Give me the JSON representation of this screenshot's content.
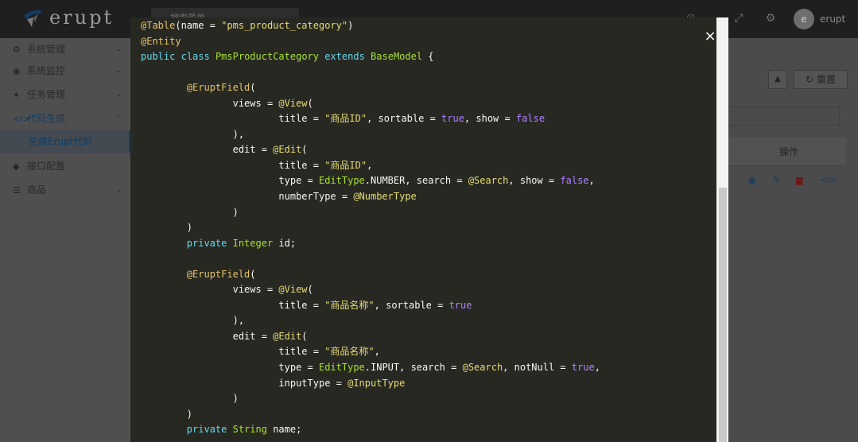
{
  "app": {
    "logo_text": "erupt",
    "search_placeholder": "搜索菜单",
    "username": "erupt",
    "avatar_letter": "e"
  },
  "sidebar": {
    "items": [
      {
        "label": "系统管理",
        "icon": "gears-icon"
      },
      {
        "label": "系统监控",
        "icon": "monitor-icon"
      },
      {
        "label": "任务管理",
        "icon": "tasks-icon"
      },
      {
        "label": "代码生成",
        "icon": "code-icon"
      },
      {
        "label": "生成Erupt代码",
        "icon": ""
      },
      {
        "label": "接口配置",
        "icon": "cube-icon"
      },
      {
        "label": "商品",
        "icon": "list-icon"
      }
    ]
  },
  "toolbar": {
    "reset_label": "重置"
  },
  "table": {
    "ops_header": "操作"
  },
  "modal": {
    "close_symbol": "×"
  },
  "code_lines": [
    "@Table(name = \"pms_product_category\")",
    "@Entity",
    "public class PmsProductCategory extends BaseModel {",
    "",
    "        @EruptField(",
    "                views = @View(",
    "                        title = \"商品ID\", sortable = true, show = false",
    "                ),",
    "                edit = @Edit(",
    "                        title = \"商品ID\",",
    "                        type = EditType.NUMBER, search = @Search, show = false,",
    "                        numberType = @NumberType",
    "                )",
    "        )",
    "        private Integer id;",
    "",
    "        @EruptField(",
    "                views = @View(",
    "                        title = \"商品名称\", sortable = true",
    "                ),",
    "                edit = @Edit(",
    "                        title = \"商品名称\",",
    "                        type = EditType.INPUT, search = @Search, notNull = true,",
    "                        inputType = @InputType",
    "                )",
    "        )",
    "        private String name;"
  ],
  "colors": {
    "code_bg": "#272822",
    "string": "#e6db74",
    "keyword": "#66d9ef",
    "annotation": "#a6e22e",
    "constant": "#ae81ff"
  }
}
